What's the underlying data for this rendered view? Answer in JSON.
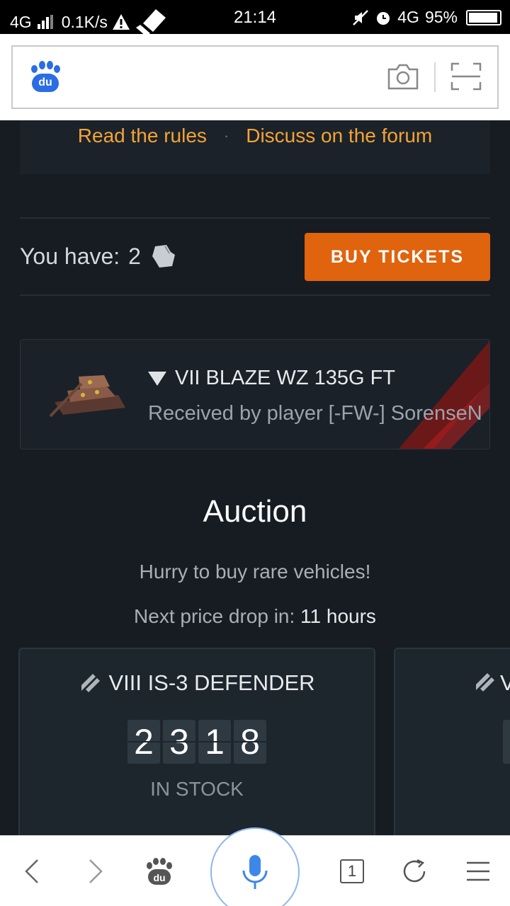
{
  "status_bar": {
    "network": "4G",
    "speed": "0.1K/s",
    "time": "21:14",
    "network_right": "4G",
    "battery": "95%"
  },
  "browser": {
    "logo_text": "du"
  },
  "rules": {
    "read_rules": "Read the rules",
    "separator": "·",
    "discuss_forum": "Discuss on the forum"
  },
  "tickets": {
    "you_have_label": "You have:",
    "count": "2",
    "buy_label": "BUY TICKETS"
  },
  "received": {
    "vehicle": "VII BLAZE WZ 135G FT",
    "subtitle": "Received by player [-FW-] SorenseN"
  },
  "auction": {
    "title": "Auction",
    "subtitle": "Hurry to buy rare vehicles!",
    "drop_label": "Next price drop in:",
    "drop_value": "11 hours",
    "lots": [
      {
        "name": "VIII IS-3 DEFENDER",
        "stock_digits": [
          "2",
          "3",
          "1",
          "8"
        ],
        "stock_label": "IN STOCK"
      },
      {
        "name": "V"
      }
    ]
  },
  "bottom_nav": {
    "tab_count": "1"
  },
  "colors": {
    "accent_orange": "#e0630e",
    "link_orange": "#f4a336",
    "background": "#161c22",
    "baidu_blue": "#2b6de5"
  }
}
